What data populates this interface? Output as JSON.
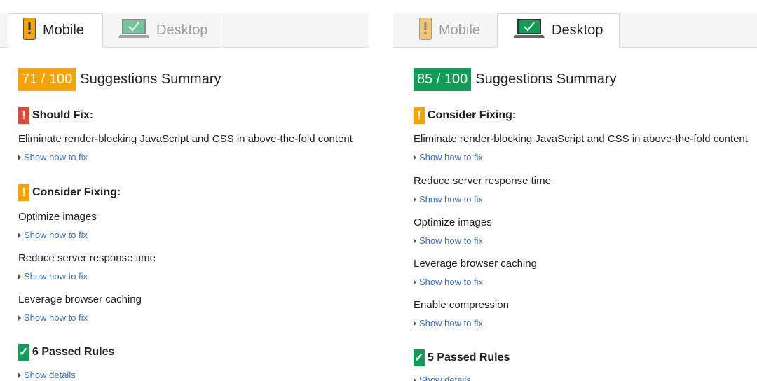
{
  "colors": {
    "orange": "#f4a300",
    "red": "#dd4b39",
    "green": "#0f9d58",
    "link": "#3b6fb4"
  },
  "left": {
    "tabs": [
      {
        "label": "Mobile",
        "icon": "mobile-phone-icon",
        "active": true
      },
      {
        "label": "Desktop",
        "icon": "desktop-monitor-icon",
        "active": false
      }
    ],
    "score": "71 / 100",
    "summary_title": "Suggestions Summary",
    "should_fix": {
      "title": "Should Fix:",
      "items": [
        {
          "text": "Eliminate render-blocking JavaScript and CSS in above-the-fold content",
          "link": "Show how to fix"
        }
      ]
    },
    "consider_fixing": {
      "title": "Consider Fixing:",
      "items": [
        {
          "text": "Optimize images",
          "link": "Show how to fix"
        },
        {
          "text": "Reduce server response time",
          "link": "Show how to fix"
        },
        {
          "text": "Leverage browser caching",
          "link": "Show how to fix"
        }
      ]
    },
    "passed": {
      "title": "6 Passed Rules",
      "link": "Show details"
    }
  },
  "right": {
    "tabs": [
      {
        "label": "Mobile",
        "icon": "mobile-phone-icon",
        "active": false
      },
      {
        "label": "Desktop",
        "icon": "desktop-monitor-icon",
        "active": true
      }
    ],
    "score": "85 / 100",
    "summary_title": "Suggestions Summary",
    "consider_fixing": {
      "title": "Consider Fixing:",
      "items": [
        {
          "text": "Eliminate render-blocking JavaScript and CSS in above-the-fold content",
          "link": "Show how to fix"
        },
        {
          "text": "Reduce server response time",
          "link": "Show how to fix"
        },
        {
          "text": "Optimize images",
          "link": "Show how to fix"
        },
        {
          "text": "Leverage browser caching",
          "link": "Show how to fix"
        },
        {
          "text": "Enable compression",
          "link": "Show how to fix"
        }
      ]
    },
    "passed": {
      "title": "5 Passed Rules",
      "link": "Show details"
    }
  }
}
